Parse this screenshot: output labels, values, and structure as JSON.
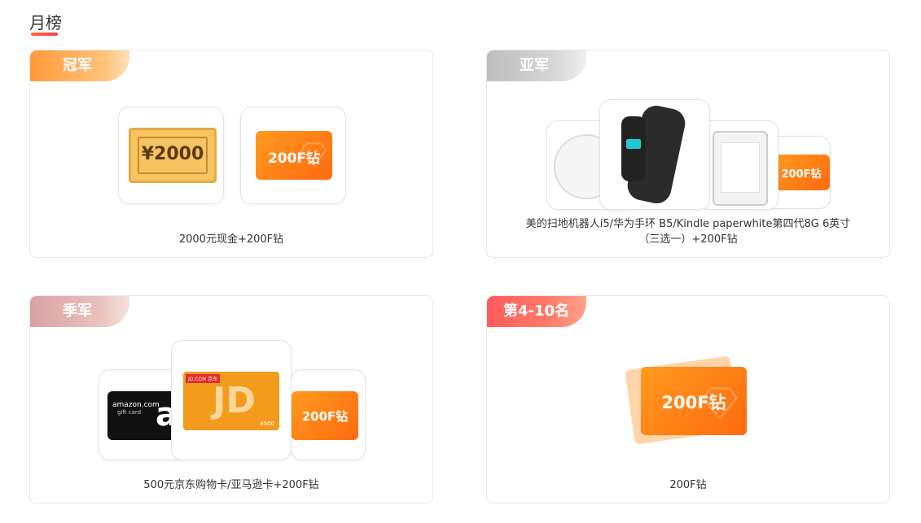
{
  "page": {
    "title": "月榜"
  },
  "cards": [
    {
      "badge": "冠军",
      "caption": "2000元现金+200F钻",
      "cash_amount": "¥2000",
      "diamond_label": "200F钻"
    },
    {
      "badge": "亚军",
      "caption_line1": "美的扫地机器人i5/华为手环 B5/Kindle paperwhite第四代8G 6英寸",
      "caption_line2": "（三选一）+200F钻",
      "diamond_label": "200F钻"
    },
    {
      "badge": "季军",
      "caption": "500元京东购物卡/亚马逊卡+200F钻",
      "amazon_text": "amazon.com",
      "amazon_sub": "gift card",
      "amazon_letter": "a",
      "jd_label": "JD.COM 京东",
      "jd_amount": "¥500",
      "diamond_label": "200F钻"
    },
    {
      "badge": "第4-10名",
      "caption": "200F钻",
      "diamond_label": "200F钻"
    }
  ],
  "colors": {
    "accent": "#ff6a0e",
    "gold": "#ff9a3c",
    "silver": "#bdbdbd",
    "bronze": "#d9a2a2",
    "pink": "#ff5b5b"
  }
}
